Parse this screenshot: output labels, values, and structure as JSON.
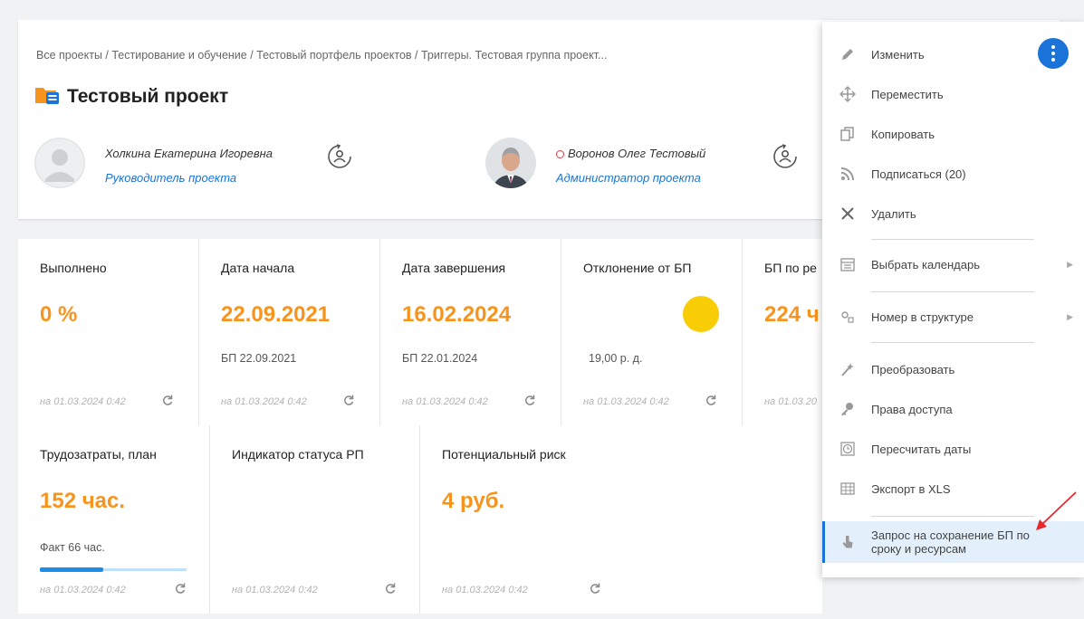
{
  "header": {
    "breadcrumb": "Все проекты / Тестирование и обучение / Тестовый портфель проектов / Триггеры. Тестовая группа проект...",
    "title": "Тестовый проект",
    "manager": {
      "name": "Холкина Екатерина Игоревна",
      "role": "Руководитель проекта"
    },
    "admin": {
      "name": "Воронов Олег Тестовый",
      "role": "Администратор проекта"
    }
  },
  "tiles_row1": [
    {
      "label": "Выполнено",
      "value": "0 %",
      "sub": "",
      "date": "на 01.03.2024 0:42"
    },
    {
      "label": "Дата начала",
      "value": "22.09.2021",
      "sub": "БП  22.09.2021",
      "date": "на 01.03.2024 0:42"
    },
    {
      "label": "Дата завершения",
      "value": "16.02.2024",
      "sub": "БП  22.01.2024",
      "date": "на 01.03.2024 0:42"
    },
    {
      "label": "Отклонение от БП",
      "value": "",
      "sub": "19,00 р. д.",
      "date": "на 01.03.2024 0:42"
    },
    {
      "label": "БП по ре",
      "value": "224 ч",
      "sub": "",
      "date": "на 01.03.20"
    }
  ],
  "tiles_row2": [
    {
      "label": "Трудозатраты, план",
      "value": "152 час.",
      "sub": "Факт  66 час.",
      "date": "на 01.03.2024 0:42"
    },
    {
      "label": "Индикатор статуса РП",
      "value": "",
      "sub": "",
      "date": "на 01.03.2024 0:42"
    },
    {
      "label": "Потенциальный риск",
      "value": "4 руб.",
      "sub": "",
      "date": "на 01.03.2024 0:42"
    }
  ],
  "progress": {
    "fact_fraction": 0.434
  },
  "status_color": "#f9cd05",
  "accent": "#f7941d",
  "link_color": "#1a73d8",
  "menu": {
    "items": [
      {
        "label": "Изменить",
        "icon": "pencil-icon"
      },
      {
        "label": "Переместить",
        "icon": "move-icon"
      },
      {
        "label": "Копировать",
        "icon": "copy-icon"
      },
      {
        "label": "Подписаться (20)",
        "icon": "rss-icon"
      },
      {
        "label": "Удалить",
        "icon": "close-icon"
      },
      {
        "label": "Выбрать календарь",
        "icon": "calendar-icon"
      },
      {
        "label": "Номер в структуре",
        "icon": "structure-icon"
      },
      {
        "label": "Преобразовать",
        "icon": "magic-wand-icon"
      },
      {
        "label": "Права доступа",
        "icon": "key-icon"
      },
      {
        "label": "Пересчитать даты",
        "icon": "clock-icon"
      },
      {
        "label": "Экспорт в XLS",
        "icon": "table-icon"
      },
      {
        "label": "Запрос на сохранение БП по сроку и ресурсам",
        "icon": "hand-pointer-icon"
      }
    ]
  }
}
